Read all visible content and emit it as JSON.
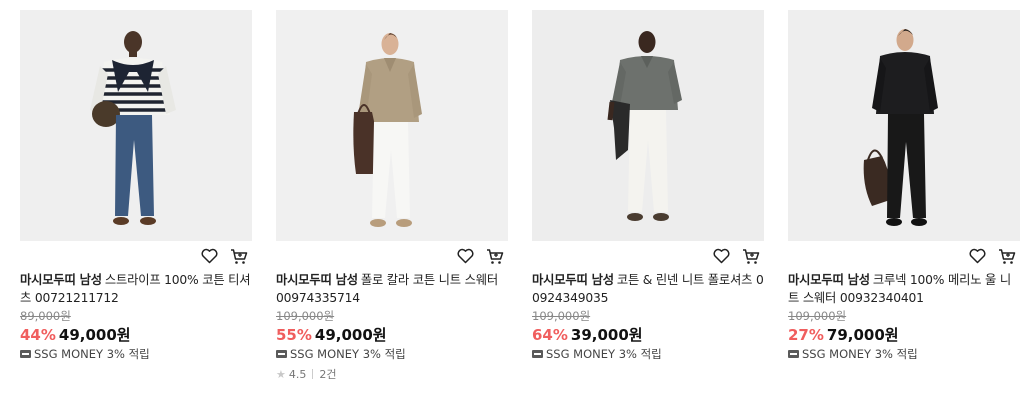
{
  "products": [
    {
      "brand": "마시모두띠 남성",
      "name": "스트라이프 100% 코튼 티셔츠 00721211712",
      "original_price": "89,000원",
      "discount": "44%",
      "price": "49,000원",
      "money": "SSG MONEY 3% 적립",
      "image_icon": "man-striped-sweater-photo"
    },
    {
      "brand": "마시모두띠 남성",
      "name": "폴로 칼라 코튼 니트 스웨터 00974335714",
      "original_price": "109,000원",
      "discount": "55%",
      "price": "49,000원",
      "money": "SSG MONEY 3% 적립",
      "rating": "4.5",
      "review_count": "2건",
      "image_icon": "man-polo-knit-photo"
    },
    {
      "brand": "마시모두띠 남성",
      "name": "코튼 & 린넨 니트 폴로셔츠 00924349035",
      "original_price": "109,000원",
      "discount": "64%",
      "price": "39,000원",
      "money": "SSG MONEY 3% 적립",
      "image_icon": "man-grey-polo-photo"
    },
    {
      "brand": "마시모두띠 남성",
      "name": "크루넥 100% 메리노 울 니트 스웨터 00932340401",
      "original_price": "109,000원",
      "discount": "27%",
      "price": "79,000원",
      "money": "SSG MONEY 3% 적립",
      "image_icon": "man-black-sweater-photo"
    }
  ],
  "colors": {
    "discount": "#f05e5e",
    "image_bg": "#eeeeee",
    "text": "#222222"
  },
  "icons": [
    "heart-icon",
    "cart-icon",
    "ssg-money-icon",
    "star-icon"
  ]
}
